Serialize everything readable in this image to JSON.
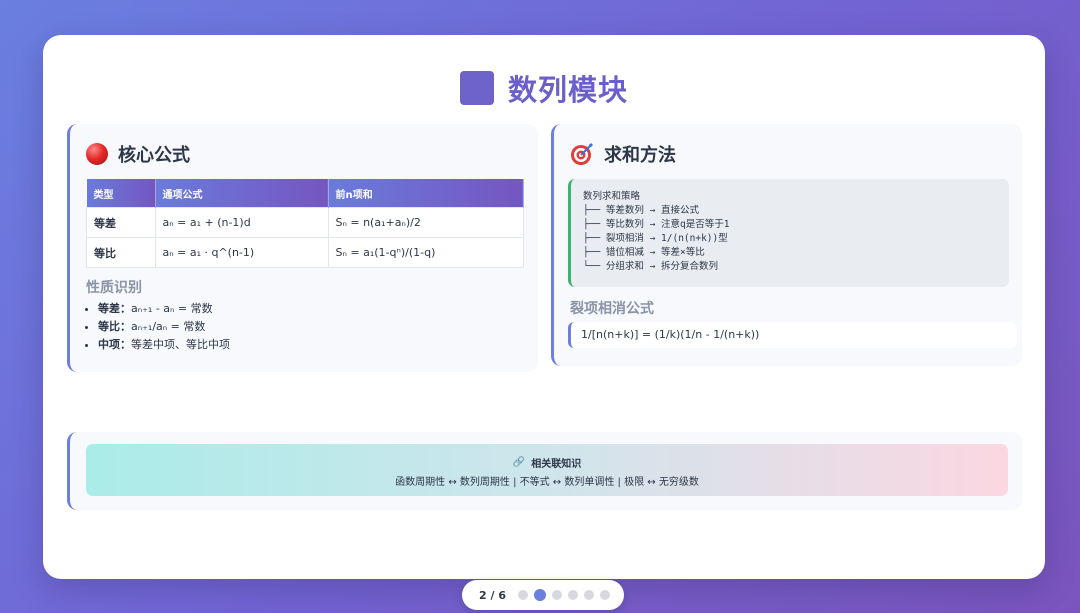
{
  "slide": {
    "title": "数列模块"
  },
  "core": {
    "heading": "核心公式",
    "table": {
      "headers": [
        "类型",
        "通项公式",
        "前n项和"
      ],
      "rows": [
        [
          "等差",
          "aₙ = a₁ + (n-1)d",
          "Sₙ = n(a₁+aₙ)/2"
        ],
        [
          "等比",
          "aₙ = a₁ · q^(n-1)",
          "Sₙ = a₁(1-qⁿ)/(1-q)"
        ]
      ]
    },
    "props_heading": "性质识别",
    "props": [
      {
        "key": "等差：",
        "val": "aₙ₊₁ - aₙ = 常数"
      },
      {
        "key": "等比：",
        "val": "aₙ₊₁/aₙ = 常数"
      },
      {
        "key": "中项：",
        "val": "等差中项、等比中项"
      }
    ]
  },
  "sum": {
    "heading": "求和方法",
    "strategy": "数列求和策略\n├── 等差数列 → 直接公式\n├── 等比数列 → 注意q是否等于1\n├── 裂项相消 → 1/(n(n+k))型\n├── 错位相减 → 等差×等比\n└── 分组求和 → 拆分复合数列",
    "formula_heading": "裂项相消公式",
    "formula": "1/[n(n+k)] = (1/k)(1/n - 1/(n+k))"
  },
  "related": {
    "title": "相关联知识",
    "line": "函数周期性 ↔ 数列周期性  |  不等式 ↔ 数列单调性  |  极限 ↔ 无穷级数"
  },
  "pager": {
    "label": "2 / 6",
    "total": 6,
    "active_index": 1
  },
  "colors": {
    "accent": "#6b7fdc",
    "title": "#6b5fcb",
    "code_border": "#3bb36b"
  },
  "icons": {
    "title": "square-icon",
    "core": "red-ball-icon",
    "sum": "target-icon",
    "related": "link-icon"
  }
}
